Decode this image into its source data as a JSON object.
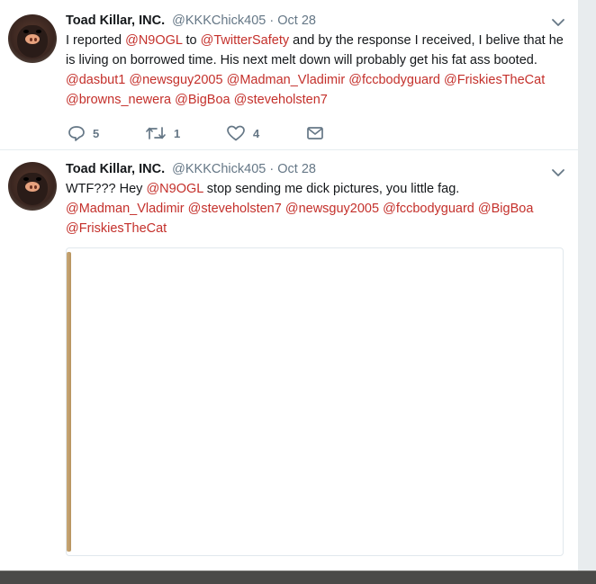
{
  "tweets": [
    {
      "name": "Toad Killar, INC.",
      "handle": "@KKKChick405",
      "separator": "·",
      "time": "Oct 28",
      "text_parts": [
        {
          "t": "I reported ",
          "m": false
        },
        {
          "t": "@N9OGL",
          "m": true
        },
        {
          "t": " to ",
          "m": false
        },
        {
          "t": "@TwitterSafety",
          "m": true
        },
        {
          "t": " and by the response I received, I belive that he is living on borrowed time. His next melt down will probably get his fat ass booted. ",
          "m": false
        },
        {
          "t": "@dasbut1",
          "m": true
        },
        {
          "t": " ",
          "m": false
        },
        {
          "t": "@newsguy2005",
          "m": true
        },
        {
          "t": " ",
          "m": false
        },
        {
          "t": "@Madman_Vladimir",
          "m": true
        },
        {
          "t": " ",
          "m": false
        },
        {
          "t": "@fccbodyguard",
          "m": true
        },
        {
          "t": " ",
          "m": false
        },
        {
          "t": "@FriskiesTheCat",
          "m": true
        },
        {
          "t": " ",
          "m": false
        },
        {
          "t": "@browns_newera",
          "m": true
        },
        {
          "t": " ",
          "m": false
        },
        {
          "t": "@BigBoa",
          "m": true
        },
        {
          "t": " ",
          "m": false
        },
        {
          "t": "@steveholsten7",
          "m": true
        }
      ],
      "actions": {
        "replies": "5",
        "retweets": "1",
        "likes": "4"
      }
    },
    {
      "name": "Toad Killar, INC.",
      "handle": "@KKKChick405",
      "separator": "·",
      "time": "Oct 28",
      "text_parts": [
        {
          "t": "WTF??? Hey ",
          "m": false
        },
        {
          "t": "@N9OGL",
          "m": true
        },
        {
          "t": " stop sending me dick pictures, you little fag. ",
          "m": false
        },
        {
          "t": "@Madman_Vladimir",
          "m": true
        },
        {
          "t": " ",
          "m": false
        },
        {
          "t": "@steveholsten7",
          "m": true
        },
        {
          "t": " ",
          "m": false
        },
        {
          "t": "@newsguy2005",
          "m": true
        },
        {
          "t": " ",
          "m": false
        },
        {
          "t": "@fccbodyguard",
          "m": true
        },
        {
          "t": " ",
          "m": false
        },
        {
          "t": "@BigBoa",
          "m": true
        },
        {
          "t": " ",
          "m": false
        },
        {
          "t": "@FriskiesTheCat",
          "m": true
        }
      ]
    }
  ],
  "icons": {
    "caret": "chevron-down-icon",
    "reply": "reply-icon",
    "retweet": "retweet-icon",
    "like": "heart-icon",
    "dm": "envelope-icon"
  },
  "colors": {
    "mention": "#c4302b",
    "secondary_text": "#657786",
    "divider": "#e6ecf0"
  }
}
